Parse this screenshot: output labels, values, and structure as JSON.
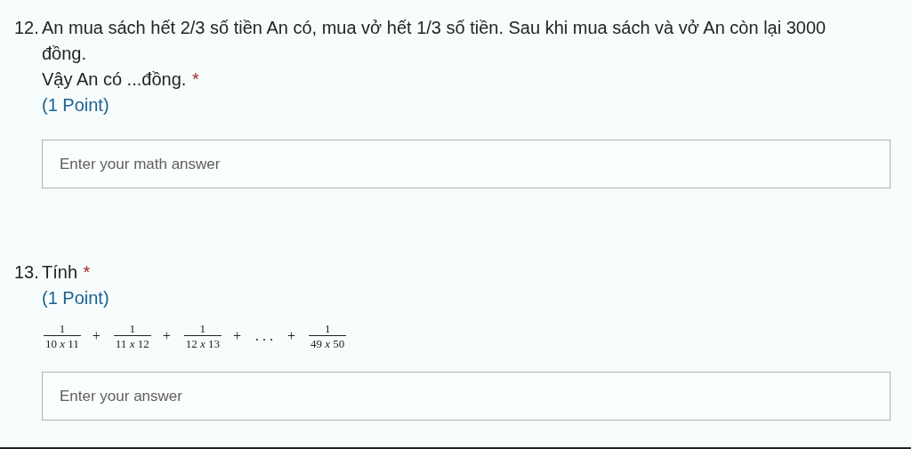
{
  "questions": [
    {
      "number": "12.",
      "lines": [
        "An mua sách hết 2/3 số tiền An có, mua vở hết 1/3 số tiền. Sau khi mua sách và vở An còn lại 3000 đồng.",
        "Vậy An có ...đồng."
      ],
      "required_mark": "*",
      "points": "(1 Point)",
      "answer": {
        "placeholder": "Enter your math answer"
      }
    },
    {
      "number": "13.",
      "lines": [
        "Tính"
      ],
      "required_mark": "*",
      "points": "(1 Point)",
      "formula": [
        {
          "kind": "fraction",
          "numerator": "1",
          "denominator": "10 *x* 11"
        },
        {
          "kind": "operator",
          "text": "+"
        },
        {
          "kind": "fraction",
          "numerator": "1",
          "denominator": "11 *x* 12"
        },
        {
          "kind": "operator",
          "text": "+"
        },
        {
          "kind": "fraction",
          "numerator": "1",
          "denominator": "12 *x* 13"
        },
        {
          "kind": "operator",
          "text": "+"
        },
        {
          "kind": "operator",
          "text": ". . ."
        },
        {
          "kind": "operator",
          "text": "+"
        },
        {
          "kind": "fraction",
          "numerator": "1",
          "denominator": "49 *x* 50"
        }
      ],
      "answer": {
        "placeholder": "Enter your answer"
      }
    }
  ]
}
